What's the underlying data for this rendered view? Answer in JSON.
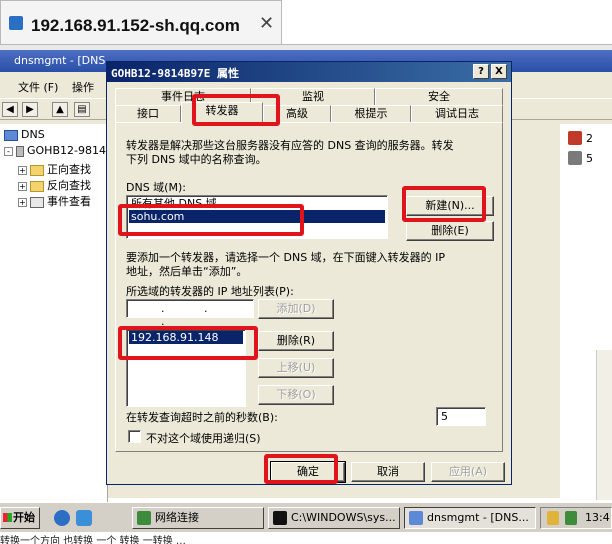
{
  "rdp": {
    "title": "192.168.91.152-sh.qq.com",
    "close_glyph": "✕"
  },
  "mmc": {
    "title": "dnsmgmt - [DNS...",
    "menu": [
      "文件 (F)",
      "操作"
    ],
    "tree": [
      {
        "label": "DNS",
        "expander": ""
      },
      {
        "label": "GOHB12-9814E",
        "expander": "-"
      },
      {
        "label": "正向查找",
        "expander": "+"
      },
      {
        "label": "反向查找",
        "expander": "+"
      },
      {
        "label": "事件查看",
        "expander": "+"
      }
    ],
    "right_icons": [
      "2",
      "5"
    ]
  },
  "dialog": {
    "title": "GOHB12-9814B97E 属性",
    "title_buttons": [
      "?",
      "X"
    ],
    "tabs_back": [
      "事件日志",
      "监视",
      "安全"
    ],
    "tabs_front": [
      "接口",
      "转发器",
      "高级",
      "根提示",
      "调试日志"
    ],
    "active_tab": "转发器",
    "description": [
      "转发器是解决那些这台服务器没有应答的 DNS 查询的服务器。转发",
      "下列 DNS 域中的名称查询。"
    ],
    "dns_domain_label": "DNS 域(M):",
    "domains": [
      "所有其他 DNS 域",
      "sohu.com"
    ],
    "selected_domain": "sohu.com",
    "new_button": "新建(N)...",
    "remove_domain_button": "删除(E)",
    "hint": [
      "要添加一个转发器，请选择一个 DNS 域，在下面键入转发器的 IP",
      "地址，然后单击“添加”。"
    ],
    "ip_list_label": "所选域的转发器的 IP 地址列表(P):",
    "ip_input": "",
    "ip_input_dots": ". . .",
    "add_button": "添加(D)",
    "forwarders": [
      "192.168.91.148"
    ],
    "remove_button": "删除(R)",
    "up_button": "上移(U)",
    "down_button": "下移(O)",
    "timeout_label": "在转发查询超时之前的秒数(B):",
    "timeout_value": "5",
    "no_recursion_label": "不对这个域使用递归(S)",
    "no_recursion_checked": false,
    "ok_button": "确定",
    "cancel_button": "取消",
    "apply_button": "应用(A)"
  },
  "taskbar": {
    "start": "开始",
    "tasks": [
      "网络连接",
      "C:\\WINDOWS\\sys...",
      "dnsmgmt - [DNS..."
    ],
    "clock": "13:4"
  },
  "footer_text": "转换一个方向 也转换 一个 转换 一转换 …"
}
